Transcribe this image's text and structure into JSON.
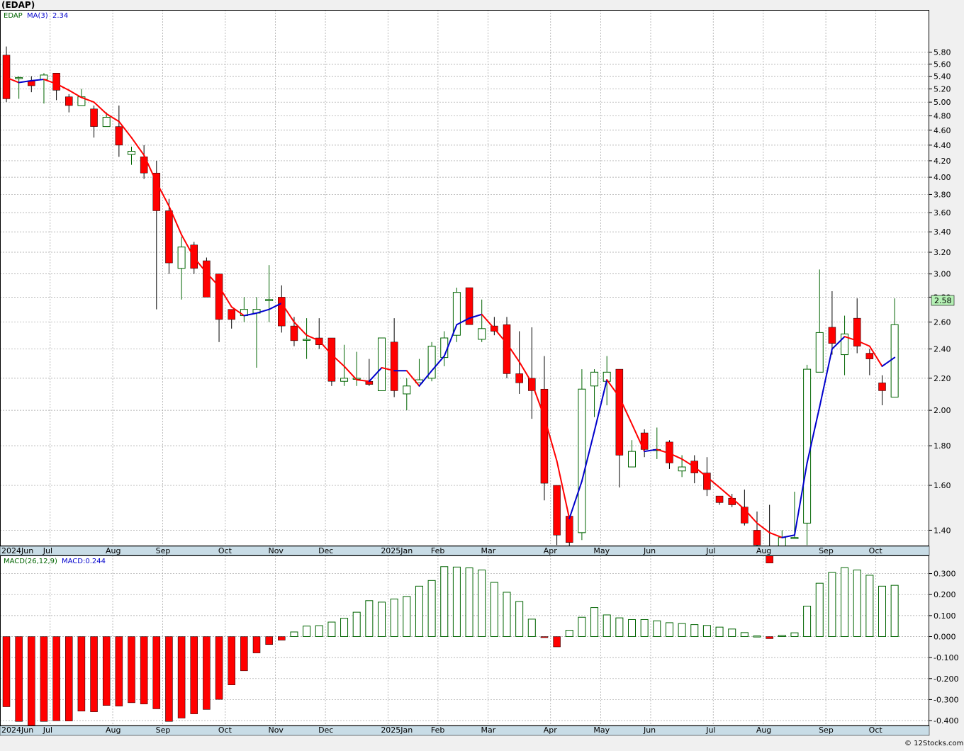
{
  "header": {
    "title": "(EDAP)",
    "credit": "© 12Stocks.com"
  },
  "colors": {
    "up_candle": "#006400",
    "down_candle": "#ff0000",
    "ma_up": "#0000cc",
    "ma_down": "#ff0000",
    "grid": "#a0a0a0",
    "axis_strip": "#c8dce6",
    "price_tag_bg": "#b4f0b4"
  },
  "chart_data": [
    {
      "type": "candlestick",
      "legend": {
        "ticker": "EDAP",
        "ma_label": "MA(3)",
        "ma_value": "2.34"
      },
      "last_price": "2.58",
      "y_ticks": [
        "5.80",
        "5.60",
        "5.40",
        "5.20",
        "5.00",
        "4.80",
        "4.60",
        "4.40",
        "4.20",
        "4.00",
        "3.80",
        "3.60",
        "3.40",
        "3.20",
        "3.00",
        "2.80",
        "2.60",
        "2.40",
        "2.20",
        "2.00",
        "1.80",
        "1.60",
        "1.40"
      ],
      "scale": "log",
      "x_month_labels": [
        "2024Jun",
        "Jul",
        "Aug",
        "Sep",
        "Oct",
        "Nov",
        "Dec",
        "2025Jan",
        "Feb",
        "Mar",
        "Apr",
        "May",
        "Jun",
        "Jul",
        "Aug",
        "Sep",
        "Oct"
      ],
      "candles": [
        {
          "o": 5.75,
          "h": 5.9,
          "l": 5.0,
          "c": 5.05
        },
        {
          "o": 5.38,
          "h": 5.4,
          "l": 5.05,
          "c": 5.38
        },
        {
          "o": 5.33,
          "h": 5.4,
          "l": 5.15,
          "c": 5.25
        },
        {
          "o": 5.35,
          "h": 5.45,
          "l": 4.98,
          "c": 5.42
        },
        {
          "o": 5.45,
          "h": 5.45,
          "l": 5.03,
          "c": 5.18
        },
        {
          "o": 5.08,
          "h": 5.12,
          "l": 4.85,
          "c": 4.95
        },
        {
          "o": 4.95,
          "h": 5.2,
          "l": 4.95,
          "c": 5.08
        },
        {
          "o": 4.9,
          "h": 4.95,
          "l": 4.5,
          "c": 4.65
        },
        {
          "o": 4.65,
          "h": 4.85,
          "l": 4.65,
          "c": 4.78
        },
        {
          "o": 4.65,
          "h": 4.95,
          "l": 4.25,
          "c": 4.4
        },
        {
          "o": 4.28,
          "h": 4.38,
          "l": 4.15,
          "c": 4.32
        },
        {
          "o": 4.25,
          "h": 4.4,
          "l": 3.98,
          "c": 4.05
        },
        {
          "o": 4.05,
          "h": 4.2,
          "l": 2.7,
          "c": 3.62
        },
        {
          "o": 3.62,
          "h": 3.75,
          "l": 3.0,
          "c": 3.1
        },
        {
          "o": 3.05,
          "h": 3.35,
          "l": 2.78,
          "c": 3.25
        },
        {
          "o": 3.27,
          "h": 3.3,
          "l": 3.0,
          "c": 3.05
        },
        {
          "o": 3.12,
          "h": 3.15,
          "l": 2.8,
          "c": 2.8
        },
        {
          "o": 3.0,
          "h": 3.0,
          "l": 2.45,
          "c": 2.62
        },
        {
          "o": 2.7,
          "h": 2.7,
          "l": 2.55,
          "c": 2.62
        },
        {
          "o": 2.65,
          "h": 2.8,
          "l": 2.6,
          "c": 2.7
        },
        {
          "o": 2.67,
          "h": 2.8,
          "l": 2.27,
          "c": 2.7
        },
        {
          "o": 2.78,
          "h": 3.08,
          "l": 2.6,
          "c": 2.78
        },
        {
          "o": 2.8,
          "h": 2.9,
          "l": 2.52,
          "c": 2.57
        },
        {
          "o": 2.57,
          "h": 2.64,
          "l": 2.42,
          "c": 2.46
        },
        {
          "o": 2.47,
          "h": 2.63,
          "l": 2.33,
          "c": 2.47
        },
        {
          "o": 2.48,
          "h": 2.63,
          "l": 2.4,
          "c": 2.43
        },
        {
          "o": 2.48,
          "h": 2.48,
          "l": 2.15,
          "c": 2.18
        },
        {
          "o": 2.18,
          "h": 2.43,
          "l": 2.15,
          "c": 2.2
        },
        {
          "o": 2.2,
          "h": 2.38,
          "l": 2.15,
          "c": 2.2
        },
        {
          "o": 2.18,
          "h": 2.33,
          "l": 2.15,
          "c": 2.16
        },
        {
          "o": 2.12,
          "h": 2.48,
          "l": 2.12,
          "c": 2.48
        },
        {
          "o": 2.45,
          "h": 2.63,
          "l": 2.08,
          "c": 2.12
        },
        {
          "o": 2.1,
          "h": 2.2,
          "l": 2.0,
          "c": 2.15
        },
        {
          "o": 2.17,
          "h": 2.33,
          "l": 2.17,
          "c": 2.19
        },
        {
          "o": 2.2,
          "h": 2.45,
          "l": 2.18,
          "c": 2.42
        },
        {
          "o": 2.34,
          "h": 2.53,
          "l": 2.28,
          "c": 2.48
        },
        {
          "o": 2.5,
          "h": 2.88,
          "l": 2.45,
          "c": 2.84
        },
        {
          "o": 2.88,
          "h": 2.88,
          "l": 2.58,
          "c": 2.58
        },
        {
          "o": 2.47,
          "h": 2.78,
          "l": 2.45,
          "c": 2.55
        },
        {
          "o": 2.57,
          "h": 2.64,
          "l": 2.5,
          "c": 2.53
        },
        {
          "o": 2.58,
          "h": 2.64,
          "l": 2.2,
          "c": 2.23
        },
        {
          "o": 2.23,
          "h": 2.53,
          "l": 2.1,
          "c": 2.17
        },
        {
          "o": 2.2,
          "h": 2.56,
          "l": 1.95,
          "c": 2.12
        },
        {
          "o": 2.13,
          "h": 2.35,
          "l": 1.53,
          "c": 1.61
        },
        {
          "o": 1.6,
          "h": 1.6,
          "l": 1.34,
          "c": 1.38
        },
        {
          "o": 1.46,
          "h": 1.46,
          "l": 1.32,
          "c": 1.35
        },
        {
          "o": 1.39,
          "h": 2.26,
          "l": 1.36,
          "c": 2.13
        },
        {
          "o": 2.15,
          "h": 2.26,
          "l": 1.96,
          "c": 2.24
        },
        {
          "o": 2.18,
          "h": 2.35,
          "l": 2.03,
          "c": 2.24
        },
        {
          "o": 2.26,
          "h": 2.26,
          "l": 1.59,
          "c": 1.75
        },
        {
          "o": 1.69,
          "h": 1.83,
          "l": 1.69,
          "c": 1.77
        },
        {
          "o": 1.87,
          "h": 1.89,
          "l": 1.74,
          "c": 1.78
        },
        {
          "o": 1.78,
          "h": 1.9,
          "l": 1.73,
          "c": 1.78
        },
        {
          "o": 1.82,
          "h": 1.83,
          "l": 1.68,
          "c": 1.71
        },
        {
          "o": 1.67,
          "h": 1.75,
          "l": 1.64,
          "c": 1.69
        },
        {
          "o": 1.72,
          "h": 1.75,
          "l": 1.61,
          "c": 1.66
        },
        {
          "o": 1.66,
          "h": 1.74,
          "l": 1.55,
          "c": 1.58
        },
        {
          "o": 1.55,
          "h": 1.55,
          "l": 1.51,
          "c": 1.52
        },
        {
          "o": 1.54,
          "h": 1.56,
          "l": 1.5,
          "c": 1.51
        },
        {
          "o": 1.5,
          "h": 1.58,
          "l": 1.42,
          "c": 1.43
        },
        {
          "o": 1.4,
          "h": 1.48,
          "l": 1.32,
          "c": 1.34
        },
        {
          "o": 1.31,
          "h": 1.51,
          "l": 1.28,
          "c": 1.27
        },
        {
          "o": 1.32,
          "h": 1.4,
          "l": 1.31,
          "c": 1.37
        },
        {
          "o": 1.37,
          "h": 1.57,
          "l": 1.37,
          "c": 1.37
        },
        {
          "o": 1.43,
          "h": 2.29,
          "l": 1.34,
          "c": 2.26
        },
        {
          "o": 2.24,
          "h": 3.04,
          "l": 2.24,
          "c": 2.52
        },
        {
          "o": 2.56,
          "h": 2.85,
          "l": 2.36,
          "c": 2.44
        },
        {
          "o": 2.36,
          "h": 2.65,
          "l": 2.22,
          "c": 2.51
        },
        {
          "o": 2.63,
          "h": 2.79,
          "l": 2.37,
          "c": 2.42
        },
        {
          "o": 2.37,
          "h": 2.4,
          "l": 2.22,
          "c": 2.33
        },
        {
          "o": 2.17,
          "h": 2.22,
          "l": 2.03,
          "c": 2.12
        },
        {
          "o": 2.08,
          "h": 2.79,
          "l": 2.08,
          "c": 2.58
        }
      ],
      "ma": [
        5.38,
        5.3,
        5.33,
        5.35,
        5.28,
        5.18,
        5.07,
        5.0,
        4.83,
        4.72,
        4.5,
        4.27,
        3.94,
        3.67,
        3.37,
        3.15,
        3.01,
        2.89,
        2.72,
        2.65,
        2.67,
        2.7,
        2.75,
        2.6,
        2.5,
        2.46,
        2.36,
        2.28,
        2.19,
        2.18,
        2.27,
        2.25,
        2.25,
        2.15,
        2.25,
        2.35,
        2.58,
        2.63,
        2.66,
        2.55,
        2.44,
        2.31,
        2.17,
        1.96,
        1.72,
        1.45,
        1.62,
        1.88,
        2.19,
        2.08,
        1.92,
        1.77,
        1.78,
        1.76,
        1.73,
        1.69,
        1.64,
        1.59,
        1.54,
        1.49,
        1.43,
        1.39,
        1.37,
        1.38,
        1.71,
        2.02,
        2.4,
        2.49,
        2.46,
        2.42,
        2.28,
        2.34
      ]
    },
    {
      "type": "bar",
      "legend": {
        "label": "MACD(26,12,9)",
        "value_label": "MACD:0.244"
      },
      "y_ticks": [
        "0.300",
        "0.200",
        "0.100",
        "0.000",
        "-0.100",
        "-0.200",
        "-0.300",
        "-0.400"
      ],
      "ylim": [
        -0.43,
        0.36
      ],
      "values": [
        -0.334,
        -0.404,
        -0.428,
        -0.404,
        -0.401,
        -0.402,
        -0.355,
        -0.358,
        -0.328,
        -0.331,
        -0.315,
        -0.321,
        -0.344,
        -0.404,
        -0.388,
        -0.368,
        -0.347,
        -0.299,
        -0.23,
        -0.163,
        -0.078,
        -0.038,
        -0.017,
        0.022,
        0.05,
        0.052,
        0.069,
        0.087,
        0.116,
        0.171,
        0.164,
        0.179,
        0.191,
        0.24,
        0.267,
        0.333,
        0.331,
        0.327,
        0.317,
        0.258,
        0.211,
        0.167,
        0.083,
        -0.002,
        -0.049,
        0.03,
        0.092,
        0.138,
        0.103,
        0.089,
        0.081,
        0.081,
        0.075,
        0.066,
        0.062,
        0.057,
        0.053,
        0.045,
        0.036,
        0.019,
        0.003,
        -0.01,
        0.006,
        0.018,
        0.145,
        0.254,
        0.305,
        0.328,
        0.317,
        0.292,
        0.24,
        0.244
      ]
    }
  ]
}
